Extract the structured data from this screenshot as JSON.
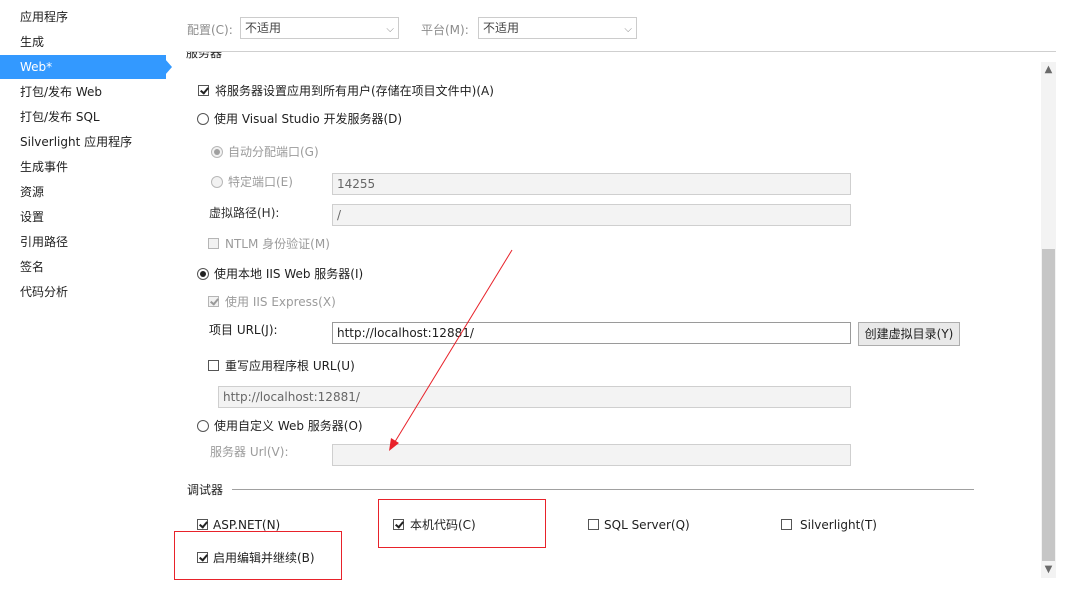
{
  "sidebar": {
    "items": [
      {
        "label": "应用程序"
      },
      {
        "label": "生成"
      },
      {
        "label": "Web*"
      },
      {
        "label": "打包/发布 Web"
      },
      {
        "label": "打包/发布 SQL"
      },
      {
        "label": "Silverlight 应用程序"
      },
      {
        "label": "生成事件"
      },
      {
        "label": "资源"
      },
      {
        "label": "设置"
      },
      {
        "label": "引用路径"
      },
      {
        "label": "签名"
      },
      {
        "label": "代码分析"
      }
    ],
    "active_index": 2
  },
  "config_bar": {
    "config_label": "配置(C):",
    "config_value": "不适用",
    "platform_label": "平台(M):",
    "platform_value": "不适用"
  },
  "servers": {
    "section_title_partial": "服务器",
    "apply_all_users": {
      "label": "将服务器设置应用到所有用户(存储在项目文件中)(A)",
      "checked": true
    },
    "vs_dev_server": {
      "label": "使用 Visual Studio 开发服务器(D)",
      "selected": false
    },
    "auto_port": {
      "label": "自动分配端口(G)",
      "selected": true
    },
    "specific_port": {
      "label": "特定端口(E)",
      "value": "14255"
    },
    "virtual_path": {
      "label": "虚拟路径(H):",
      "value": "/"
    },
    "ntlm": {
      "label": "NTLM 身份验证(M)",
      "checked": false
    },
    "local_iis": {
      "label": "使用本地 IIS Web 服务器(I)",
      "selected": true
    },
    "iis_express": {
      "label": "使用 IIS Express(X)",
      "checked": true
    },
    "project_url": {
      "label": "项目 URL(J):",
      "value": "http://localhost:12881/"
    },
    "create_vdir_button": "创建虚拟目录(Y)",
    "override_root": {
      "label": "重写应用程序根 URL(U)",
      "checked": false,
      "value": "http://localhost:12881/"
    },
    "custom_server": {
      "label": "使用自定义 Web 服务器(O)",
      "selected": false
    },
    "server_url": {
      "label": "服务器 Url(V):",
      "value": ""
    }
  },
  "debuggers": {
    "section_title": "调试器",
    "aspnet": {
      "label": "ASP.NET(N)",
      "checked": true
    },
    "native": {
      "label": "本机代码(C)",
      "checked": true
    },
    "sql": {
      "label": "SQL Server(Q)",
      "checked": false
    },
    "silverlight": {
      "label": "Silverlight(T)",
      "checked": false
    },
    "edit_continue": {
      "label": "启用编辑并继续(B)",
      "checked": true
    }
  },
  "colors": {
    "accent": "#3399ff",
    "annotation": "#e8222a"
  },
  "icons": {
    "scroll_up": "chevron-up-icon",
    "scroll_down": "chevron-down-icon",
    "combo": "chevron-down-icon"
  }
}
